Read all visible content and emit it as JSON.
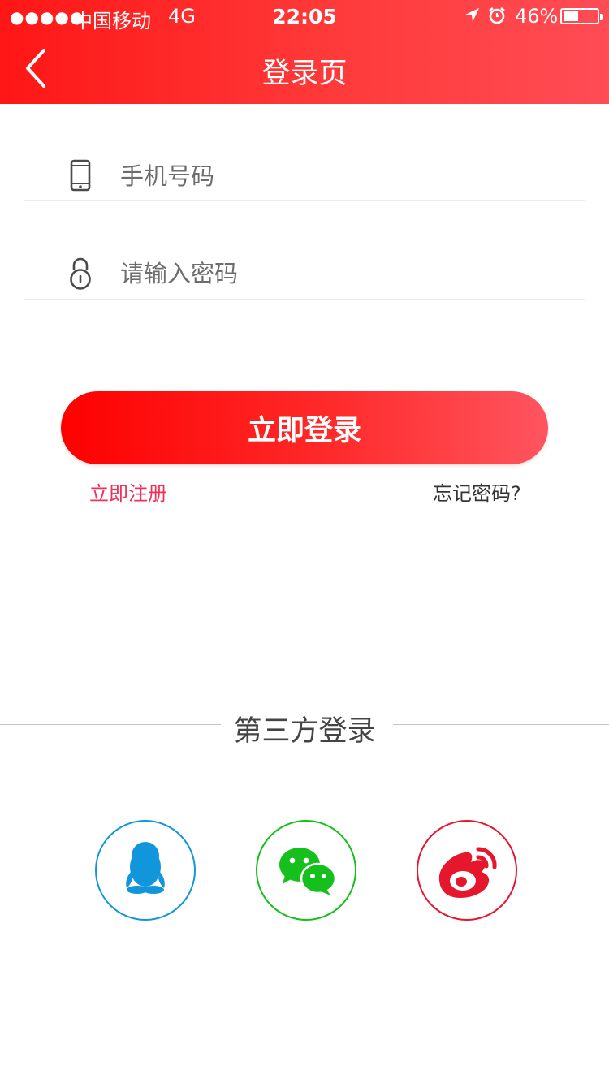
{
  "status_bar": {
    "signal": "●●●●●",
    "carrier": "中国移动",
    "network": "4G",
    "time": "22:05",
    "battery": "46%"
  },
  "header": {
    "title": "登录页",
    "back_icon": "chevron-left-icon"
  },
  "form": {
    "phone": {
      "icon": "phone-icon",
      "placeholder": "手机号码",
      "value": ""
    },
    "password": {
      "icon": "lock-icon",
      "placeholder": "请输入密码",
      "value": ""
    }
  },
  "actions": {
    "login_label": "立即登录",
    "register_label": "立即注册",
    "forgot_label": "忘记密码?"
  },
  "third_party": {
    "title": "第三方登录",
    "providers": [
      {
        "icon": "qq-icon",
        "color": "#1296db"
      },
      {
        "icon": "wechat-icon",
        "color": "#15c01c"
      },
      {
        "icon": "weibo-icon",
        "color": "#e6162d"
      }
    ]
  },
  "colors": {
    "accent": "#ff1616",
    "register_link": "#f0315a"
  }
}
